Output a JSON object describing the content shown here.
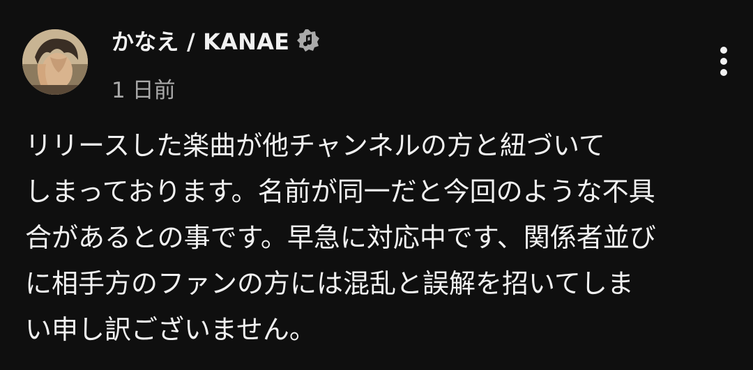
{
  "post": {
    "author": {
      "name": "かなえ / KANAE",
      "verified_icon": "music-note-verified-icon"
    },
    "timestamp": "1 日前",
    "menu_icon": "more-vertical-icon",
    "body_lines": [
      "リリースした楽曲が他チャンネルの方と紐づいて",
      "しまっております。名前が同一だと今回のような不具",
      "合があるとの事です。早急に対応中です、関係者並び",
      "に相手方のファンの方には混乱と誤解を招いてしま",
      "い申し訳ございません。"
    ]
  }
}
